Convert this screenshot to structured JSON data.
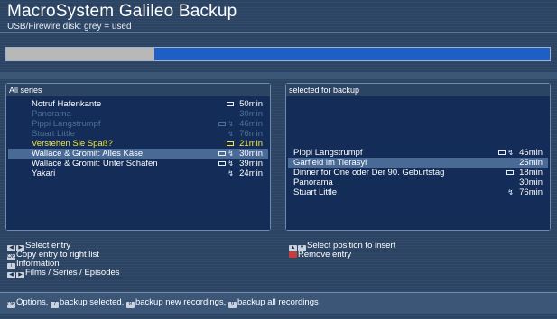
{
  "app": {
    "title": "MacroSystem Galileo Backup",
    "subtitle": "USB/Firewire disk: grey = used"
  },
  "disk_usage": {
    "used_fraction": 0.27,
    "used_color": "#b8b8b8",
    "free_color": "#1d5fc4"
  },
  "left_panel": {
    "header": "All series",
    "rows": [
      {
        "name": "Notruf Hafenkante",
        "icon": "disk",
        "duration": "50min",
        "state": "normal"
      },
      {
        "name": "Panorama",
        "icon": "",
        "duration": "30min",
        "state": "dim"
      },
      {
        "name": "Pippi Langstrumpf",
        "icon": "disk-hd",
        "duration": "46min",
        "state": "dim"
      },
      {
        "name": "Stuart Little",
        "icon": "hd",
        "duration": "76min",
        "state": "dim"
      },
      {
        "name": "Verstehen Sie Spaß?",
        "icon": "disk",
        "duration": "21min",
        "state": "highlight"
      },
      {
        "name": "Wallace & Gromit: Alles Käse",
        "icon": "disk-hd",
        "duration": "30min",
        "state": "selected"
      },
      {
        "name": "Wallace & Gromit: Unter Schafen",
        "icon": "disk-hd",
        "duration": "39min",
        "state": "normal"
      },
      {
        "name": "Yakari",
        "icon": "hd",
        "duration": "24min",
        "state": "normal"
      }
    ]
  },
  "right_panel": {
    "header": "selected for backup",
    "rows": [
      {
        "name": "Pippi Langstrumpf",
        "icon": "disk-hd",
        "duration": "46min",
        "state": "normal"
      },
      {
        "name": "Garfield im Tierasyl",
        "icon": "",
        "duration": "25min",
        "state": "selected"
      },
      {
        "name": "Dinner for One oder Der 90. Geburtstag",
        "icon": "disk",
        "duration": "18min",
        "state": "normal"
      },
      {
        "name": "Panorama",
        "icon": "",
        "duration": "30min",
        "state": "normal"
      },
      {
        "name": "Stuart Little",
        "icon": "hd",
        "duration": "76min",
        "state": "normal"
      }
    ]
  },
  "help_left": {
    "select": "Select entry",
    "copy": "Copy entry to right list",
    "info": "Information",
    "films": "Films / Series / Episodes"
  },
  "help_right": {
    "position": "Select position to insert",
    "remove": "Remove entry"
  },
  "bottom_bar": {
    "options": "Options,",
    "backup_selected": "backup selected,",
    "backup_new": "backup new recordings,",
    "backup_all": "backup all recordings"
  },
  "keys": {
    "ok": "OK",
    "i": "i",
    "seven": "7",
    "eight": "8",
    "nine": "9"
  },
  "icons": {
    "disk": "■",
    "hd": "↯"
  }
}
